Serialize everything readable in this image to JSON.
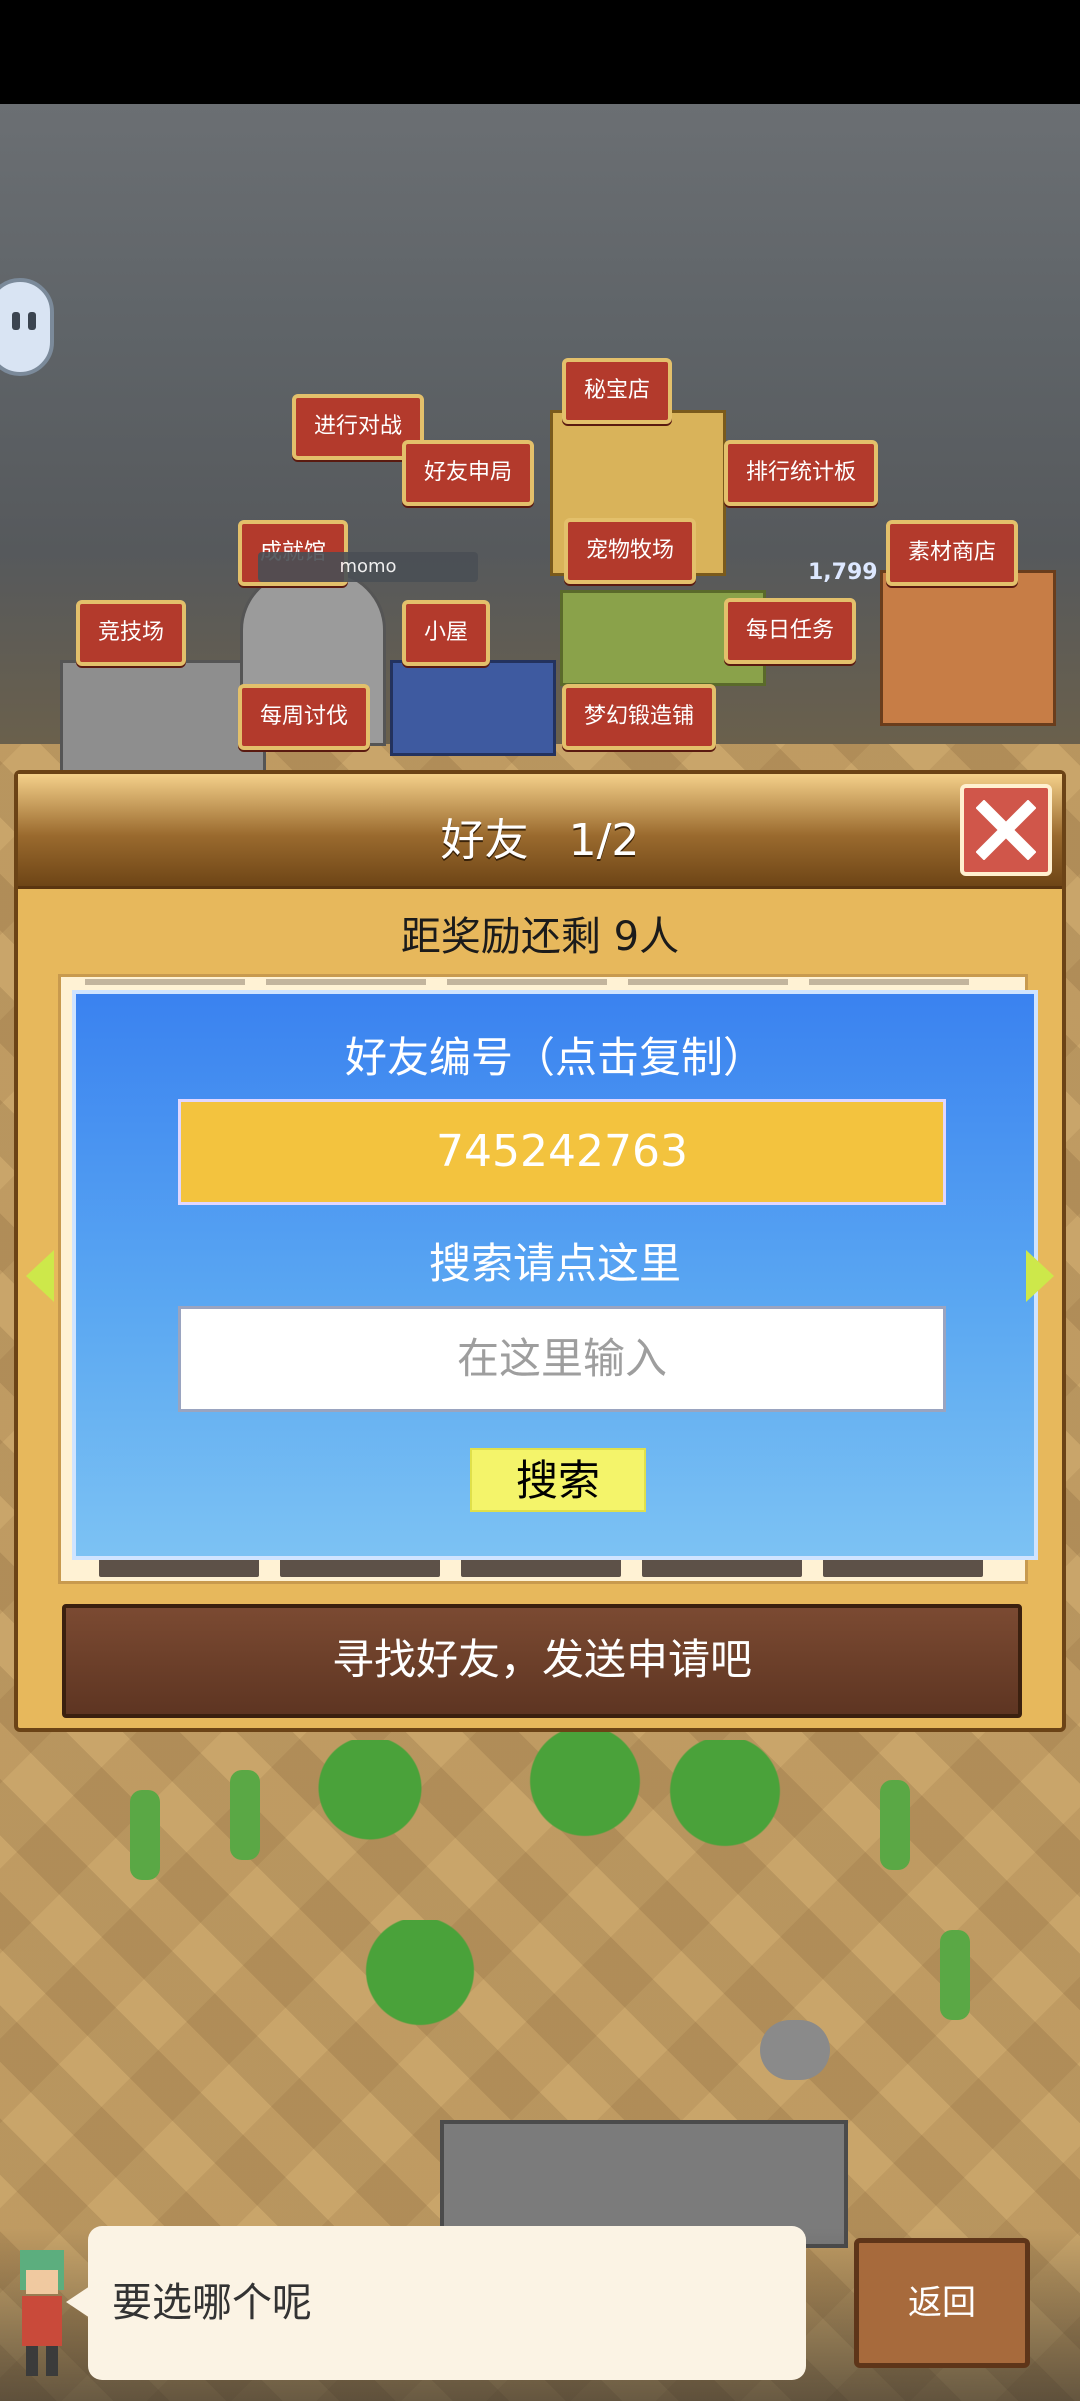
{
  "map": {
    "signs": [
      {
        "label": "秘宝店"
      },
      {
        "label": "进行对战"
      },
      {
        "label": "好友申局"
      },
      {
        "label": "排行统计板"
      },
      {
        "label": "成就馆"
      },
      {
        "label": "宠物牧场"
      },
      {
        "label": "素材商店"
      },
      {
        "label": "竞技场"
      },
      {
        "label": "小屋"
      },
      {
        "label": "每日任务"
      },
      {
        "label": "每周讨伐"
      },
      {
        "label": "梦幻锻造铺"
      }
    ],
    "player_name": "momo",
    "score_text": "1,799"
  },
  "dialog": {
    "title": "好友",
    "page": "1/2",
    "reward_text": "距奖励还剩 9人",
    "friend_id_label": "好友编号（点击复制）",
    "friend_id": "745242763",
    "search_label": "搜索请点这里",
    "search_placeholder": "在这里输入",
    "search_button": "搜索",
    "banner_text": "寻找好友，发送申请吧"
  },
  "footer": {
    "speech": "要选哪个呢",
    "back_button": "返回"
  },
  "colors": {
    "panel_blue": "#3a82f0",
    "id_box": "#f3c33e",
    "search_button": "#f4f46a",
    "close_red": "#d0564a"
  }
}
